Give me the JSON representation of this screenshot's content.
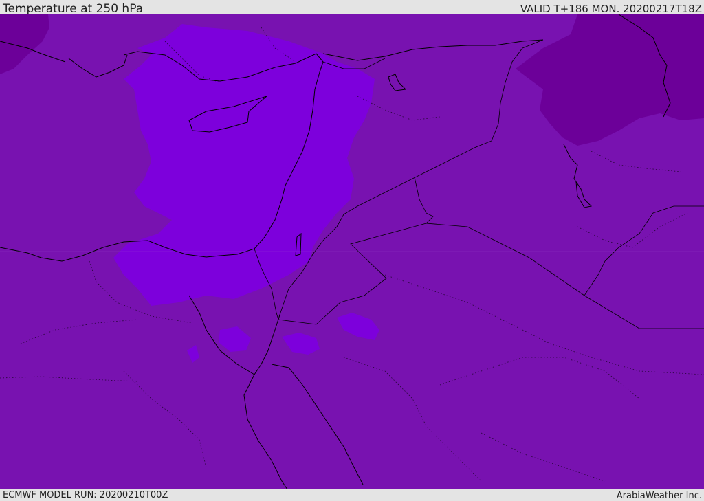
{
  "header": {
    "title": "Temperature at 250 hPa",
    "valid": "VALID T+186 MON. 20200217T18Z"
  },
  "footer": {
    "model_run": "ECMWF MODEL RUN: 20200210T00Z",
    "brand": "ArabiaWeather Inc."
  },
  "map": {
    "variable": "temperature",
    "level": "250 hPa",
    "colors": {
      "background_band": "#7812b0",
      "warm_band": "#7d00dc",
      "cold_band": "#6c0099",
      "coastline": "#000000"
    }
  }
}
